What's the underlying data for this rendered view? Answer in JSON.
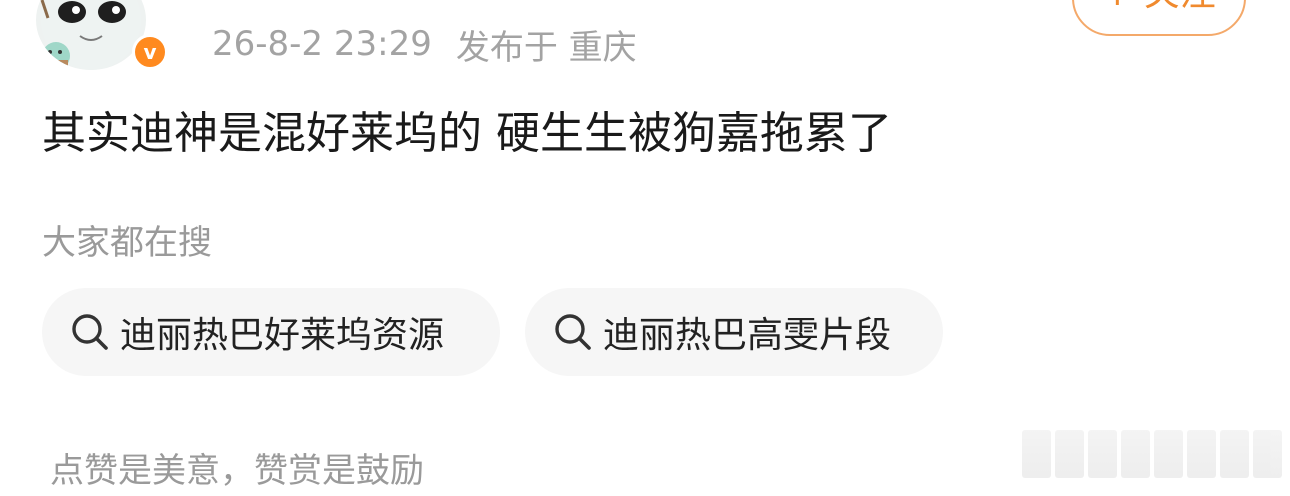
{
  "post": {
    "meta": {
      "time": "26-8-2 23:29",
      "location_label": "发布于 重庆"
    },
    "follow_label": "+ 关注",
    "text": "其实迪神是混好莱坞的 硬生生被狗嘉拖累了"
  },
  "trending": {
    "title": "大家都在搜",
    "items": [
      {
        "label": "迪丽热巴好莱坞资源",
        "icon": "search-icon"
      },
      {
        "label": "迪丽热巴高雯片段",
        "icon": "search-icon"
      }
    ]
  },
  "footer": {
    "tip": "点赞是美意，赞赏是鼓励"
  },
  "colors": {
    "accent": "#ff8a1f",
    "text_primary": "#1a1a1a",
    "text_secondary": "#a3a3a3",
    "chip_bg": "#f6f6f6"
  }
}
